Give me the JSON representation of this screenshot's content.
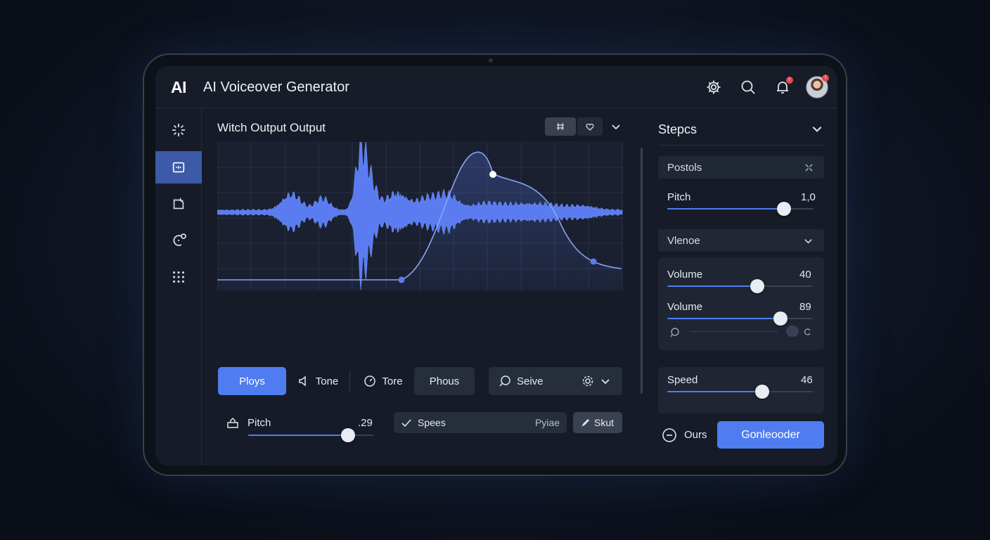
{
  "app": {
    "logo": "AI",
    "title": "AI Voiceover Generator",
    "notification_badge": "!",
    "avatar_badge": "!"
  },
  "sidebar": {
    "items": [
      {
        "name": "sparkle-icon",
        "active": false
      },
      {
        "name": "voice-box-icon",
        "active": true
      },
      {
        "name": "document-icon",
        "active": false
      },
      {
        "name": "refresh-circle-icon",
        "active": false
      },
      {
        "name": "grid-icon",
        "active": false
      }
    ]
  },
  "main": {
    "title": "Witch Output Output",
    "controls": {
      "play_label": "Ploys",
      "tone_label": "Tone",
      "tore_label": "Tore",
      "phous_label": "Phous",
      "save_label": "Seive"
    },
    "pitch": {
      "label": "Pitch",
      "value": ".29",
      "level": 0.8
    },
    "speed_box": {
      "label": "Spees",
      "value": "Pyiae"
    },
    "start_label": "Skut"
  },
  "waveform": {
    "grid": true,
    "accent": "#5b7cf0",
    "curve_color": "#8aa4f2"
  },
  "right": {
    "title": "Stepcs",
    "section1": {
      "label": "Postols",
      "pitch_label": "Pitch",
      "pitch_value": "1,0",
      "pitch_level": 0.8
    },
    "section2": {
      "label": "Vlenoe",
      "volume1_label": "Volume",
      "volume1_value": "40",
      "volume1_level": 0.62,
      "volume2_label": "Volume",
      "volume2_value": "89",
      "volume2_level": 0.78
    },
    "speed": {
      "label": "Speed",
      "value": "46",
      "level": 0.65
    },
    "ours_label": "Ours",
    "generate_label": "Gonleooder"
  },
  "colors": {
    "accent": "#4f7cf0",
    "background": "#161b27",
    "badge": "#e5484d"
  }
}
